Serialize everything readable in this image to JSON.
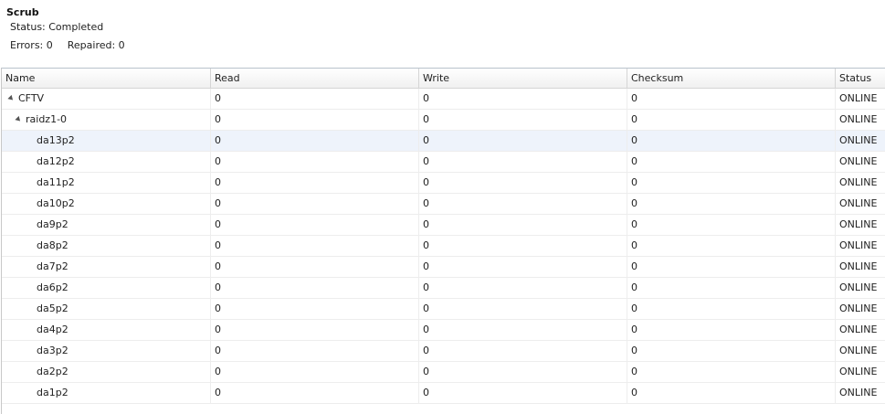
{
  "scrub": {
    "title": "Scrub",
    "status": "Status: Completed",
    "errors": "Errors: 0",
    "repaired": "Repaired: 0"
  },
  "columns": [
    "Name",
    "Read",
    "Write",
    "Checksum",
    "Status"
  ],
  "rows": [
    {
      "name": "CFTV",
      "level": 1,
      "expanded": true,
      "read": "0",
      "write": "0",
      "checksum": "0",
      "status": "ONLINE"
    },
    {
      "name": "raidz1-0",
      "level": 2,
      "expanded": true,
      "read": "0",
      "write": "0",
      "checksum": "0",
      "status": "ONLINE"
    },
    {
      "name": "da13p2",
      "level": 3,
      "read": "0",
      "write": "0",
      "checksum": "0",
      "status": "ONLINE",
      "highlighted": true
    },
    {
      "name": "da12p2",
      "level": 3,
      "read": "0",
      "write": "0",
      "checksum": "0",
      "status": "ONLINE"
    },
    {
      "name": "da11p2",
      "level": 3,
      "read": "0",
      "write": "0",
      "checksum": "0",
      "status": "ONLINE"
    },
    {
      "name": "da10p2",
      "level": 3,
      "read": "0",
      "write": "0",
      "checksum": "0",
      "status": "ONLINE"
    },
    {
      "name": "da9p2",
      "level": 3,
      "read": "0",
      "write": "0",
      "checksum": "0",
      "status": "ONLINE"
    },
    {
      "name": "da8p2",
      "level": 3,
      "read": "0",
      "write": "0",
      "checksum": "0",
      "status": "ONLINE"
    },
    {
      "name": "da7p2",
      "level": 3,
      "read": "0",
      "write": "0",
      "checksum": "0",
      "status": "ONLINE"
    },
    {
      "name": "da6p2",
      "level": 3,
      "read": "0",
      "write": "0",
      "checksum": "0",
      "status": "ONLINE"
    },
    {
      "name": "da5p2",
      "level": 3,
      "read": "0",
      "write": "0",
      "checksum": "0",
      "status": "ONLINE"
    },
    {
      "name": "da4p2",
      "level": 3,
      "read": "0",
      "write": "0",
      "checksum": "0",
      "status": "ONLINE"
    },
    {
      "name": "da3p2",
      "level": 3,
      "read": "0",
      "write": "0",
      "checksum": "0",
      "status": "ONLINE"
    },
    {
      "name": "da2p2",
      "level": 3,
      "read": "0",
      "write": "0",
      "checksum": "0",
      "status": "ONLINE"
    },
    {
      "name": "da1p2",
      "level": 3,
      "read": "0",
      "write": "0",
      "checksum": "0",
      "status": "ONLINE"
    }
  ],
  "colors": {
    "highlight_row": "#eef3fb",
    "header_border": "#b9c3cc"
  },
  "icons": {
    "expander": "collapse-triangle-icon"
  }
}
